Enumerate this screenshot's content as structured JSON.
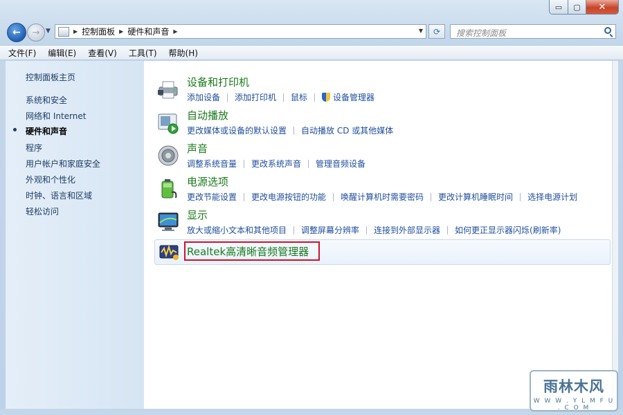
{
  "window": {
    "controls": {
      "minimize": "▭",
      "maximize": "▢",
      "close": "✕"
    }
  },
  "nav": {
    "back_icon": "←",
    "forward_icon": "→",
    "recent_icon": "▼",
    "breadcrumbs": [
      "控制面板",
      "硬件和声音"
    ],
    "refresh_icon": "⟳",
    "search_placeholder": "搜索控制面板"
  },
  "menu": [
    "文件(F)",
    "编辑(E)",
    "查看(V)",
    "工具(T)",
    "帮助(H)"
  ],
  "sidebar": {
    "home": "控制面板主页",
    "items": [
      "系统和安全",
      "网络和 Internet",
      "硬件和声音",
      "程序",
      "用户帐户和家庭安全",
      "外观和个性化",
      "时钟、语言和区域",
      "轻松访问"
    ],
    "current_index": 2
  },
  "categories": [
    {
      "title": "设备和打印机",
      "icon": "printer-icon",
      "links": [
        "添加设备",
        "添加打印机",
        "鼠标",
        "设备管理器"
      ]
    },
    {
      "title": "自动播放",
      "icon": "autoplay-icon",
      "links": [
        "更改媒体或设备的默认设置",
        "自动播放 CD 或其他媒体"
      ]
    },
    {
      "title": "声音",
      "icon": "speaker-icon",
      "links": [
        "调整系统音量",
        "更改系统声音",
        "管理音频设备"
      ]
    },
    {
      "title": "电源选项",
      "icon": "battery-icon",
      "links": [
        "更改节能设置",
        "更改电源按钮的功能",
        "唤醒计算机时需要密码",
        "更改计算机睡眠时间",
        "选择电源计划"
      ]
    },
    {
      "title": "显示",
      "icon": "monitor-icon",
      "links": [
        "放大或缩小文本和其他项目",
        "调整屏幕分辨率",
        "连接到外部显示器",
        "如何更正显示器闪烁(刷新率)"
      ]
    }
  ],
  "realtek": {
    "title": "Realtek高清晰音频管理器",
    "icon": "realtek-audio-icon",
    "highlight_color": "#d0112b"
  },
  "watermark": {
    "text": "雨林木风",
    "url": "W W W . Y L M F U . C O M"
  },
  "colors": {
    "link": "#1f4e9c",
    "category_title": "#1a7a1a",
    "sidebar_bg": "#dde9f5"
  }
}
